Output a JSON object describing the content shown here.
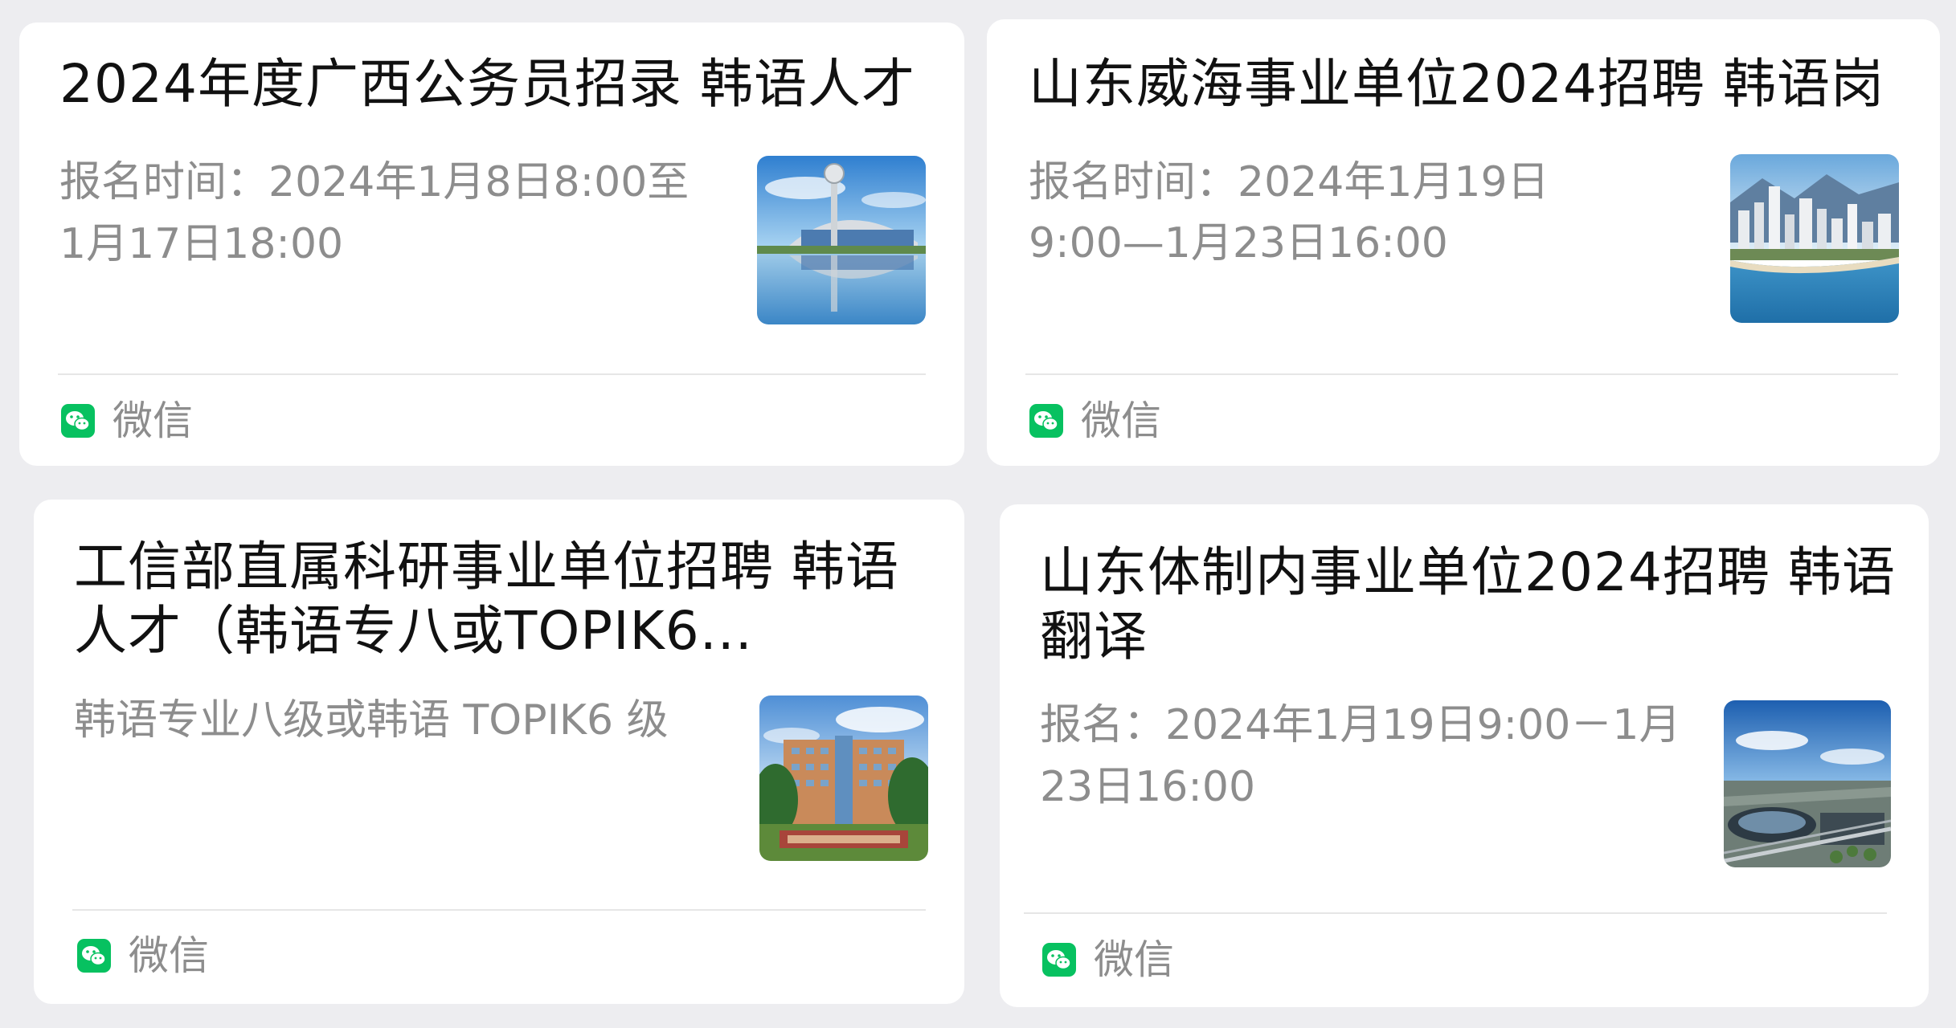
{
  "cards": [
    {
      "title_lines": [
        "2024年度广西公务员招录 韩语人才"
      ],
      "desc_lines": [
        "报名时间：2024年1月8日8:00至",
        "1月17日18:00"
      ],
      "source": "微信"
    },
    {
      "title_lines": [
        "山东威海事业单位2024招聘 韩语岗"
      ],
      "desc_lines": [
        "报名时间：2024年1月19日",
        "9:00—1月23日16:00"
      ],
      "source": "微信"
    },
    {
      "title_lines": [
        "工信部直属科研事业单位招聘 韩语",
        "人才（韩语专八或TOPIK6..."
      ],
      "desc_lines": [
        "韩语专业八级或韩语 TOPIK6 级"
      ],
      "source": "微信"
    },
    {
      "title_lines": [
        "山东体制内事业单位2024招聘 韩语",
        "翻译"
      ],
      "desc_lines": [
        "报名：2024年1月19日9:00－1月",
        "23日16:00"
      ],
      "source": "微信"
    }
  ],
  "icons": {
    "source_icon": "wechat-icon",
    "thumbnails": [
      "building-reflection-thumbnail",
      "coastal-city-thumbnail",
      "campus-building-thumbnail",
      "city-aerial-thumbnail"
    ]
  },
  "colors": {
    "background": "#ededf0",
    "card": "#ffffff",
    "title_text": "#111111",
    "secondary_text": "#8d8d8d",
    "wechat_green": "#07c160"
  }
}
